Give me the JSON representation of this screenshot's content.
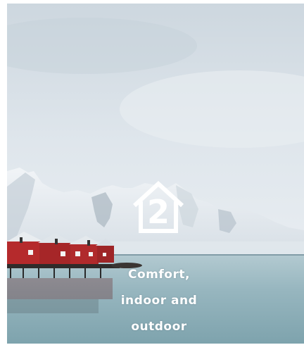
{
  "tile": {
    "image": "Red wooden cabins on stilts by a calm fjord below snowy mountains",
    "badge_icon": "house-outline-icon",
    "badge_number": "2",
    "caption_lines": [
      "Comfort,",
      "indoor and",
      "outdoor"
    ]
  },
  "colors": {
    "sky": "#d9e2e9",
    "water": "#8fb1bb",
    "cabin_red": "#b52a2c",
    "text": "#ffffff"
  }
}
